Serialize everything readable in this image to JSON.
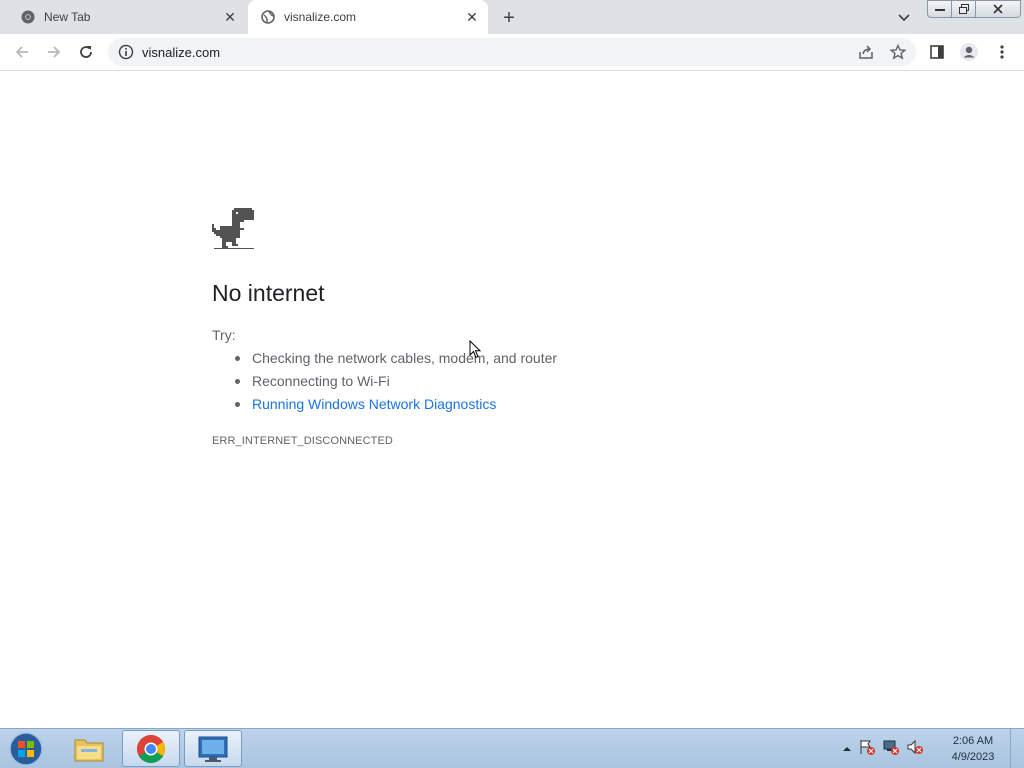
{
  "tabs": [
    {
      "title": "New Tab",
      "favicon": "chrome-icon",
      "active": false
    },
    {
      "title": "visnalize.com",
      "favicon": "globe-icon",
      "active": true
    }
  ],
  "toolbar": {
    "url": "visnalize.com"
  },
  "error_page": {
    "heading": "No internet",
    "try_label": "Try:",
    "suggestions": [
      "Checking the network cables, modem, and router",
      "Reconnecting to Wi-Fi",
      "Running Windows Network Diagnostics"
    ],
    "error_code": "ERR_INTERNET_DISCONNECTED"
  },
  "taskbar": {
    "time": "2:06 AM",
    "date": "4/9/2023"
  },
  "colors": {
    "link": "#1a73e8",
    "tabstrip": "#dee1e6",
    "omnibox": "#f1f3f4"
  }
}
